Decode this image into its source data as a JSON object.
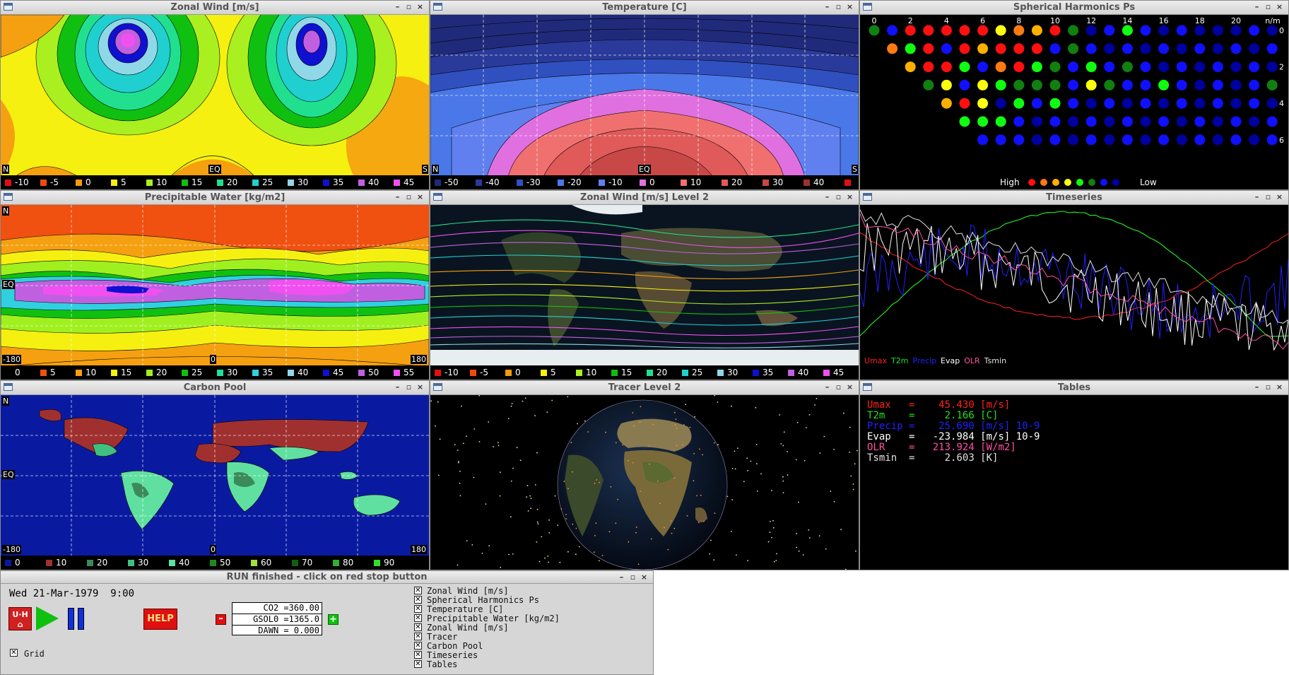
{
  "windows": {
    "zonal_wind": {
      "title": "Zonal Wind [m/s]",
      "edge_labels": {
        "left": "N",
        "center": "EQ",
        "right": "S"
      },
      "legend": [
        {
          "value": "-10",
          "color": "#e01010"
        },
        {
          "value": "-5",
          "color": "#f04a10"
        },
        {
          "value": "0",
          "color": "#f59a10"
        },
        {
          "value": "5",
          "color": "#f5f010"
        },
        {
          "value": "10",
          "color": "#aaf020"
        },
        {
          "value": "15",
          "color": "#10c010"
        },
        {
          "value": "20",
          "color": "#20e090"
        },
        {
          "value": "25",
          "color": "#20d0d0"
        },
        {
          "value": "30",
          "color": "#90d8e8"
        },
        {
          "value": "35",
          "color": "#1010d0"
        },
        {
          "value": "40",
          "color": "#c060e0"
        },
        {
          "value": "45",
          "color": "#f050f0"
        }
      ]
    },
    "temperature": {
      "title": "Temperature [C]",
      "edge_labels": {
        "left": "N",
        "center": "EQ",
        "right": "S"
      },
      "legend": [
        {
          "value": "-50",
          "color": "#202a7a"
        },
        {
          "value": "-40",
          "color": "#2a3a9a"
        },
        {
          "value": "-30",
          "color": "#3050c0"
        },
        {
          "value": "-20",
          "color": "#4a78e8"
        },
        {
          "value": "-10",
          "color": "#6080f0"
        },
        {
          "value": "0",
          "color": "#e070e0"
        },
        {
          "value": "10",
          "color": "#f07070"
        },
        {
          "value": "20",
          "color": "#e05a5a"
        },
        {
          "value": "30",
          "color": "#c84848"
        },
        {
          "value": "40",
          "color": "#a03030"
        },
        {
          "value": "",
          "color": "#e01010"
        }
      ]
    },
    "spherical_harmonics": {
      "title": "Spherical Harmonics Ps",
      "n_labels": [
        "0",
        "2",
        "4",
        "6",
        "8",
        "10",
        "12",
        "14",
        "16",
        "18",
        "20",
        "n/m"
      ],
      "m_labels": [
        "0",
        "2",
        "4",
        "6"
      ],
      "legend_high": "High",
      "legend_low": "Low",
      "legend_colors": [
        "#ff1010",
        "#ff7a10",
        "#ffb000",
        "#ffff10",
        "#10ff10",
        "#108010",
        "#1010ff",
        "#0000a0"
      ]
    },
    "precipitable_water": {
      "title": "Precipitable Water [kg/m2]",
      "edge_labels": {
        "top": "N",
        "mid": "EQ",
        "left": "-180",
        "center": "0",
        "right": "180"
      },
      "legend": [
        {
          "value": "0",
          "color": "#000000"
        },
        {
          "value": "5",
          "color": "#f05010"
        },
        {
          "value": "10",
          "color": "#f5a010"
        },
        {
          "value": "15",
          "color": "#f5f010"
        },
        {
          "value": "20",
          "color": "#a0f020"
        },
        {
          "value": "25",
          "color": "#10c010"
        },
        {
          "value": "30",
          "color": "#20e0a0"
        },
        {
          "value": "35",
          "color": "#30d0e0"
        },
        {
          "value": "40",
          "color": "#90d8f0"
        },
        {
          "value": "45",
          "color": "#1010d0"
        },
        {
          "value": "50",
          "color": "#c060e0"
        },
        {
          "value": "55",
          "color": "#f050f0"
        }
      ]
    },
    "zonal_wind_level2": {
      "title": "Zonal Wind [m/s] Level 2",
      "legend": [
        {
          "value": "-10",
          "color": "#e01010"
        },
        {
          "value": "-5",
          "color": "#f04a10"
        },
        {
          "value": "0",
          "color": "#f59a10"
        },
        {
          "value": "5",
          "color": "#f5f010"
        },
        {
          "value": "10",
          "color": "#aaf020"
        },
        {
          "value": "15",
          "color": "#10c010"
        },
        {
          "value": "20",
          "color": "#20e090"
        },
        {
          "value": "25",
          "color": "#20d0d0"
        },
        {
          "value": "30",
          "color": "#90d8e8"
        },
        {
          "value": "35",
          "color": "#1010d0"
        },
        {
          "value": "40",
          "color": "#c060e0"
        },
        {
          "value": "45",
          "color": "#f050f0"
        }
      ]
    },
    "timeseries": {
      "title": "Timeseries",
      "series": [
        {
          "name": "Umax",
          "color": "#ff2020"
        },
        {
          "name": "T2m",
          "color": "#20e020"
        },
        {
          "name": "Precip",
          "color": "#2020ff"
        },
        {
          "name": "Evap",
          "color": "#ffffff"
        },
        {
          "name": "OLR",
          "color": "#ff50a0"
        },
        {
          "name": "Tsmin",
          "color": "#e0e0e0"
        }
      ]
    },
    "carbon_pool": {
      "title": "Carbon Pool",
      "edge_labels": {
        "top": "N",
        "mid": "EQ",
        "left": "-180",
        "center": "0",
        "right": "180"
      },
      "legend": [
        {
          "value": "0",
          "color": "#0a1aa0"
        },
        {
          "value": "10",
          "color": "#a03030"
        },
        {
          "value": "20",
          "color": "#3a8a5a"
        },
        {
          "value": "30",
          "color": "#40c080"
        },
        {
          "value": "40",
          "color": "#60e0a0"
        },
        {
          "value": "50",
          "color": "#208a20"
        },
        {
          "value": "60",
          "color": "#a0e040"
        },
        {
          "value": "70",
          "color": "#106010"
        },
        {
          "value": "80",
          "color": "#30b030"
        },
        {
          "value": "90",
          "color": "#30e030"
        }
      ]
    },
    "tracer": {
      "title": "Tracer Level 2"
    },
    "tables": {
      "title": "Tables",
      "rows": [
        {
          "name": "Umax",
          "value": "45.430",
          "unit": "[m/s]",
          "color": "#ff2020"
        },
        {
          "name": "T2m",
          "value": "2.166",
          "unit": "[C]",
          "color": "#20e020"
        },
        {
          "name": "Precip",
          "value": "25.690",
          "unit": "[m/s] 10-9",
          "color": "#2020ff"
        },
        {
          "name": "Evap",
          "value": "-23.984",
          "unit": "[m/s] 10-9",
          "color": "#ffffff"
        },
        {
          "name": "OLR",
          "value": "213.924",
          "unit": "[W/m2]",
          "color": "#ff50a0"
        },
        {
          "name": "Tsmin",
          "value": "2.603",
          "unit": "[K]",
          "color": "#e0e0e0"
        }
      ]
    }
  },
  "control": {
    "title": "RUN finished - click on red stop button",
    "datetime": "Wed 21-Mar-1979  9:00",
    "help_label": "HELP",
    "params": [
      "CO2 =360.00",
      "GSOL0 =1365.0",
      "DAWN = 0.000"
    ],
    "grid_label": "Grid",
    "layers": [
      "Zonal Wind [m/s]",
      "Spherical Harmonics Ps",
      "Temperature [C]",
      "Precipitable Water [kg/m2]",
      "Zonal Wind [m/s]",
      "Tracer",
      "Carbon Pool",
      "Timeseries",
      "Tables"
    ]
  }
}
